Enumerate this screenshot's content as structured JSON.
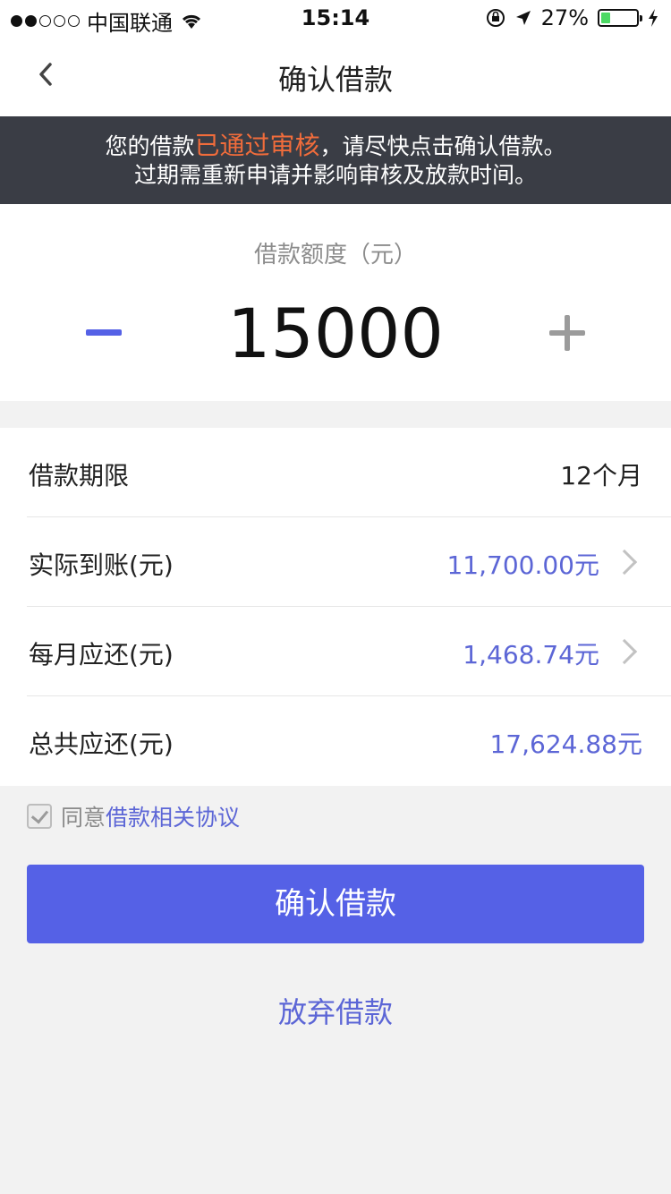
{
  "status_bar": {
    "carrier": "中国联通",
    "time": "15:14",
    "battery": "27%",
    "battery_level": 0.27,
    "icons": [
      "signal-dots-icon",
      "wifi-icon",
      "rotation-lock-icon",
      "location-arrow-icon",
      "battery-icon",
      "charging-bolt-icon"
    ]
  },
  "nav": {
    "title": "确认借款",
    "back_icon": "chevron-left-icon"
  },
  "notice": {
    "line1_prefix": "您的借款",
    "line1_highlight": "已通过审核",
    "line1_suffix": "，请尽快点击确认借款。",
    "line2": "过期需重新申请并影响审核及放款时间。",
    "highlight_color": "#f06c3b"
  },
  "amount": {
    "label": "借款额度（元）",
    "value": "15000"
  },
  "details": [
    {
      "key": "借款期限",
      "value": "12个月"
    },
    {
      "key": "实际到账(元)",
      "value": "11,700.00元"
    },
    {
      "key": "每月应还(元)",
      "value": "1,468.74元"
    },
    {
      "key": "总共应还(元)",
      "value": "17,624.88元"
    }
  ],
  "agreement": {
    "prefix": "同意",
    "link": "借款相关协议",
    "checked": true
  },
  "buttons": {
    "confirm": "确认借款",
    "abandon": "放弃借款"
  },
  "colors": {
    "accent": "#5561e6",
    "value_text": "#5c66d6",
    "notice_bg": "#3a3d45"
  }
}
